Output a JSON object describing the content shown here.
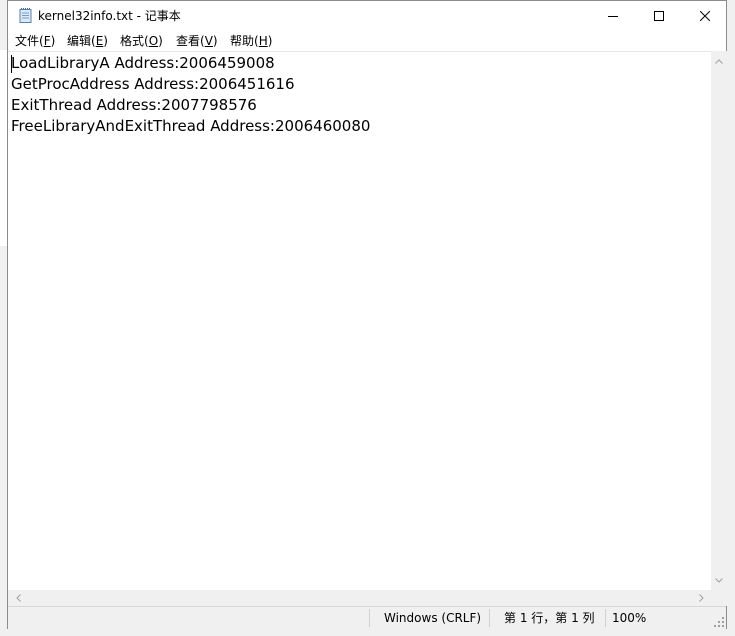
{
  "window": {
    "title": "kernel32info.txt - 记事本"
  },
  "menu": [
    {
      "label": "文件(",
      "key": "F",
      "tail": ")"
    },
    {
      "label": "编辑(",
      "key": "E",
      "tail": ")"
    },
    {
      "label": "格式(",
      "key": "O",
      "tail": ")"
    },
    {
      "label": "查看(",
      "key": "V",
      "tail": ")"
    },
    {
      "label": "帮助(",
      "key": "H",
      "tail": ")"
    }
  ],
  "document": {
    "lines": [
      "LoadLibraryA Address:2006459008",
      "GetProcAddress Address:2006451616",
      "ExitThread Address:2007798576",
      "FreeLibraryAndExitThread Address:2006460080"
    ]
  },
  "status": {
    "encoding": "Windows (CRLF)",
    "position": "第 1 行，第 1 列",
    "zoom": "100%"
  },
  "colors": {
    "chrome": "#f0f0f0",
    "text": "#000000",
    "arrow": "#a0a0a0"
  }
}
